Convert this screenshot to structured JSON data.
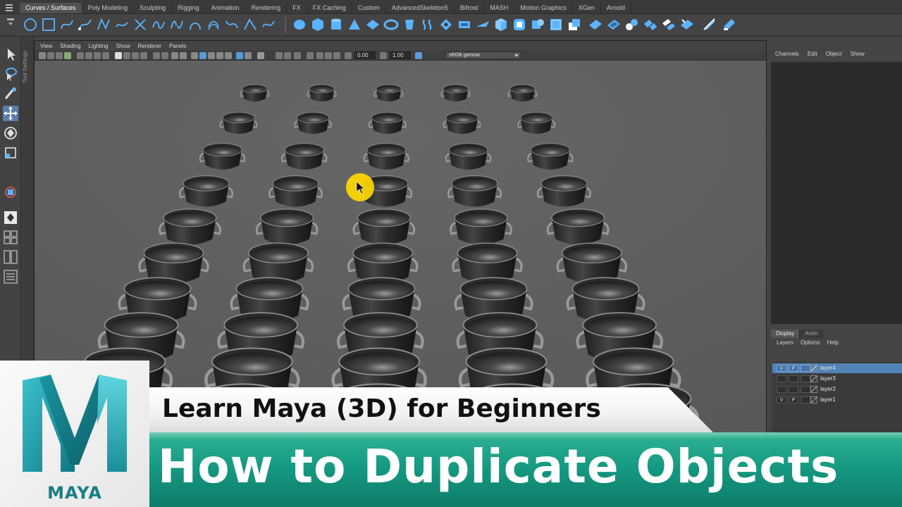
{
  "shelf": {
    "tabs": [
      "Curves / Surfaces",
      "Poly Modeling",
      "Sculpting",
      "Rigging",
      "Animation",
      "Rendering",
      "FX",
      "FX Caching",
      "Custom",
      "AdvancedSkeleton5",
      "Bifrost",
      "MASH",
      "Motion Graphics",
      "XGen",
      "Arnold"
    ],
    "active_tab": "Curves / Surfaces",
    "accent_color": "#5ab4ff"
  },
  "toolbox": {
    "side_label": "Tool Settings",
    "tools": [
      "select-arrow-icon",
      "lasso-select-icon",
      "paint-select-icon",
      "move-tool-icon",
      "rotate-tool-icon",
      "scale-tool-icon",
      "universal-manipulator-icon",
      "single-pane-layout-icon",
      "four-pane-layout-icon",
      "two-pane-layout-icon",
      "outliner-layout-icon"
    ],
    "active_tool": "move-tool-icon"
  },
  "viewport": {
    "menu": [
      "View",
      "Shading",
      "Lighting",
      "Show",
      "Renderer",
      "Panels"
    ],
    "exposure_value": "0.00",
    "gamma_value": "1.00",
    "color_space": "sRGB gamma",
    "background_color": "#5b5b5b",
    "cursor_highlight_color": "#ffd800"
  },
  "channel_box": {
    "menu": [
      "Channels",
      "Edit",
      "Object",
      "Show"
    ]
  },
  "layer_editor": {
    "tabs": [
      "Display",
      "Anim"
    ],
    "active_tab": "Display",
    "menu": [
      "Layers",
      "Options",
      "Help"
    ],
    "layers": [
      {
        "name": "layer4",
        "v": "V",
        "p": "P",
        "selected": true
      },
      {
        "name": "layer3",
        "v": "",
        "p": "",
        "selected": false
      },
      {
        "name": "layer2",
        "v": "",
        "p": "",
        "selected": false
      },
      {
        "name": "layer1",
        "v": "V",
        "p": "P",
        "selected": false
      }
    ],
    "selection_color": "#5283b8"
  },
  "overlay": {
    "logo_text": "MAYA",
    "subtitle": "Learn Maya (3D) for Beginners",
    "title": "How to Duplicate Objects",
    "title_band_color": "#169a82",
    "logo_teal": "#1a8f9a"
  }
}
